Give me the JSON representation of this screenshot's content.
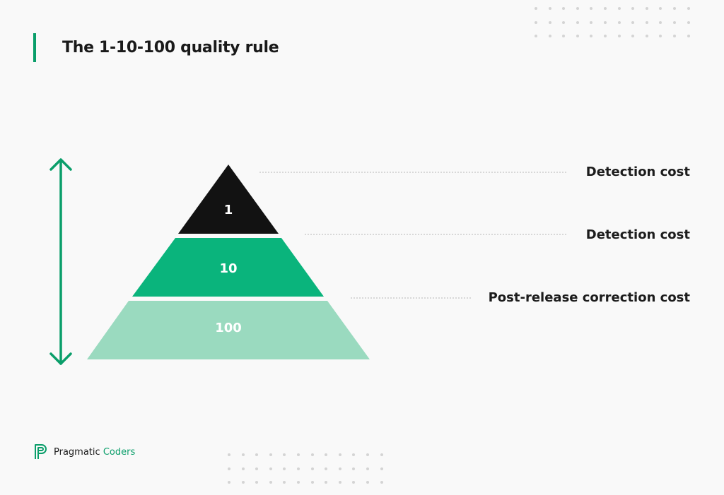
{
  "header": {
    "title": "The 1-10-100 quality rule"
  },
  "colors": {
    "accent": "#0a9e6a",
    "tier_top": "#121212",
    "tier_middle": "#0ab47c",
    "tier_bottom": "#9adabf"
  },
  "pyramid": {
    "tiers": [
      {
        "value": "1",
        "label": "Detection cost"
      },
      {
        "value": "10",
        "label": "Detection cost"
      },
      {
        "value": "100",
        "label": "Post-release correction cost"
      }
    ]
  },
  "arrow": {
    "icon": "double-arrow-vertical-icon"
  },
  "footer": {
    "brand_primary": "Pragmatic",
    "brand_secondary": "Coders",
    "logo_icon": "pragmatic-coders-logo-icon"
  }
}
